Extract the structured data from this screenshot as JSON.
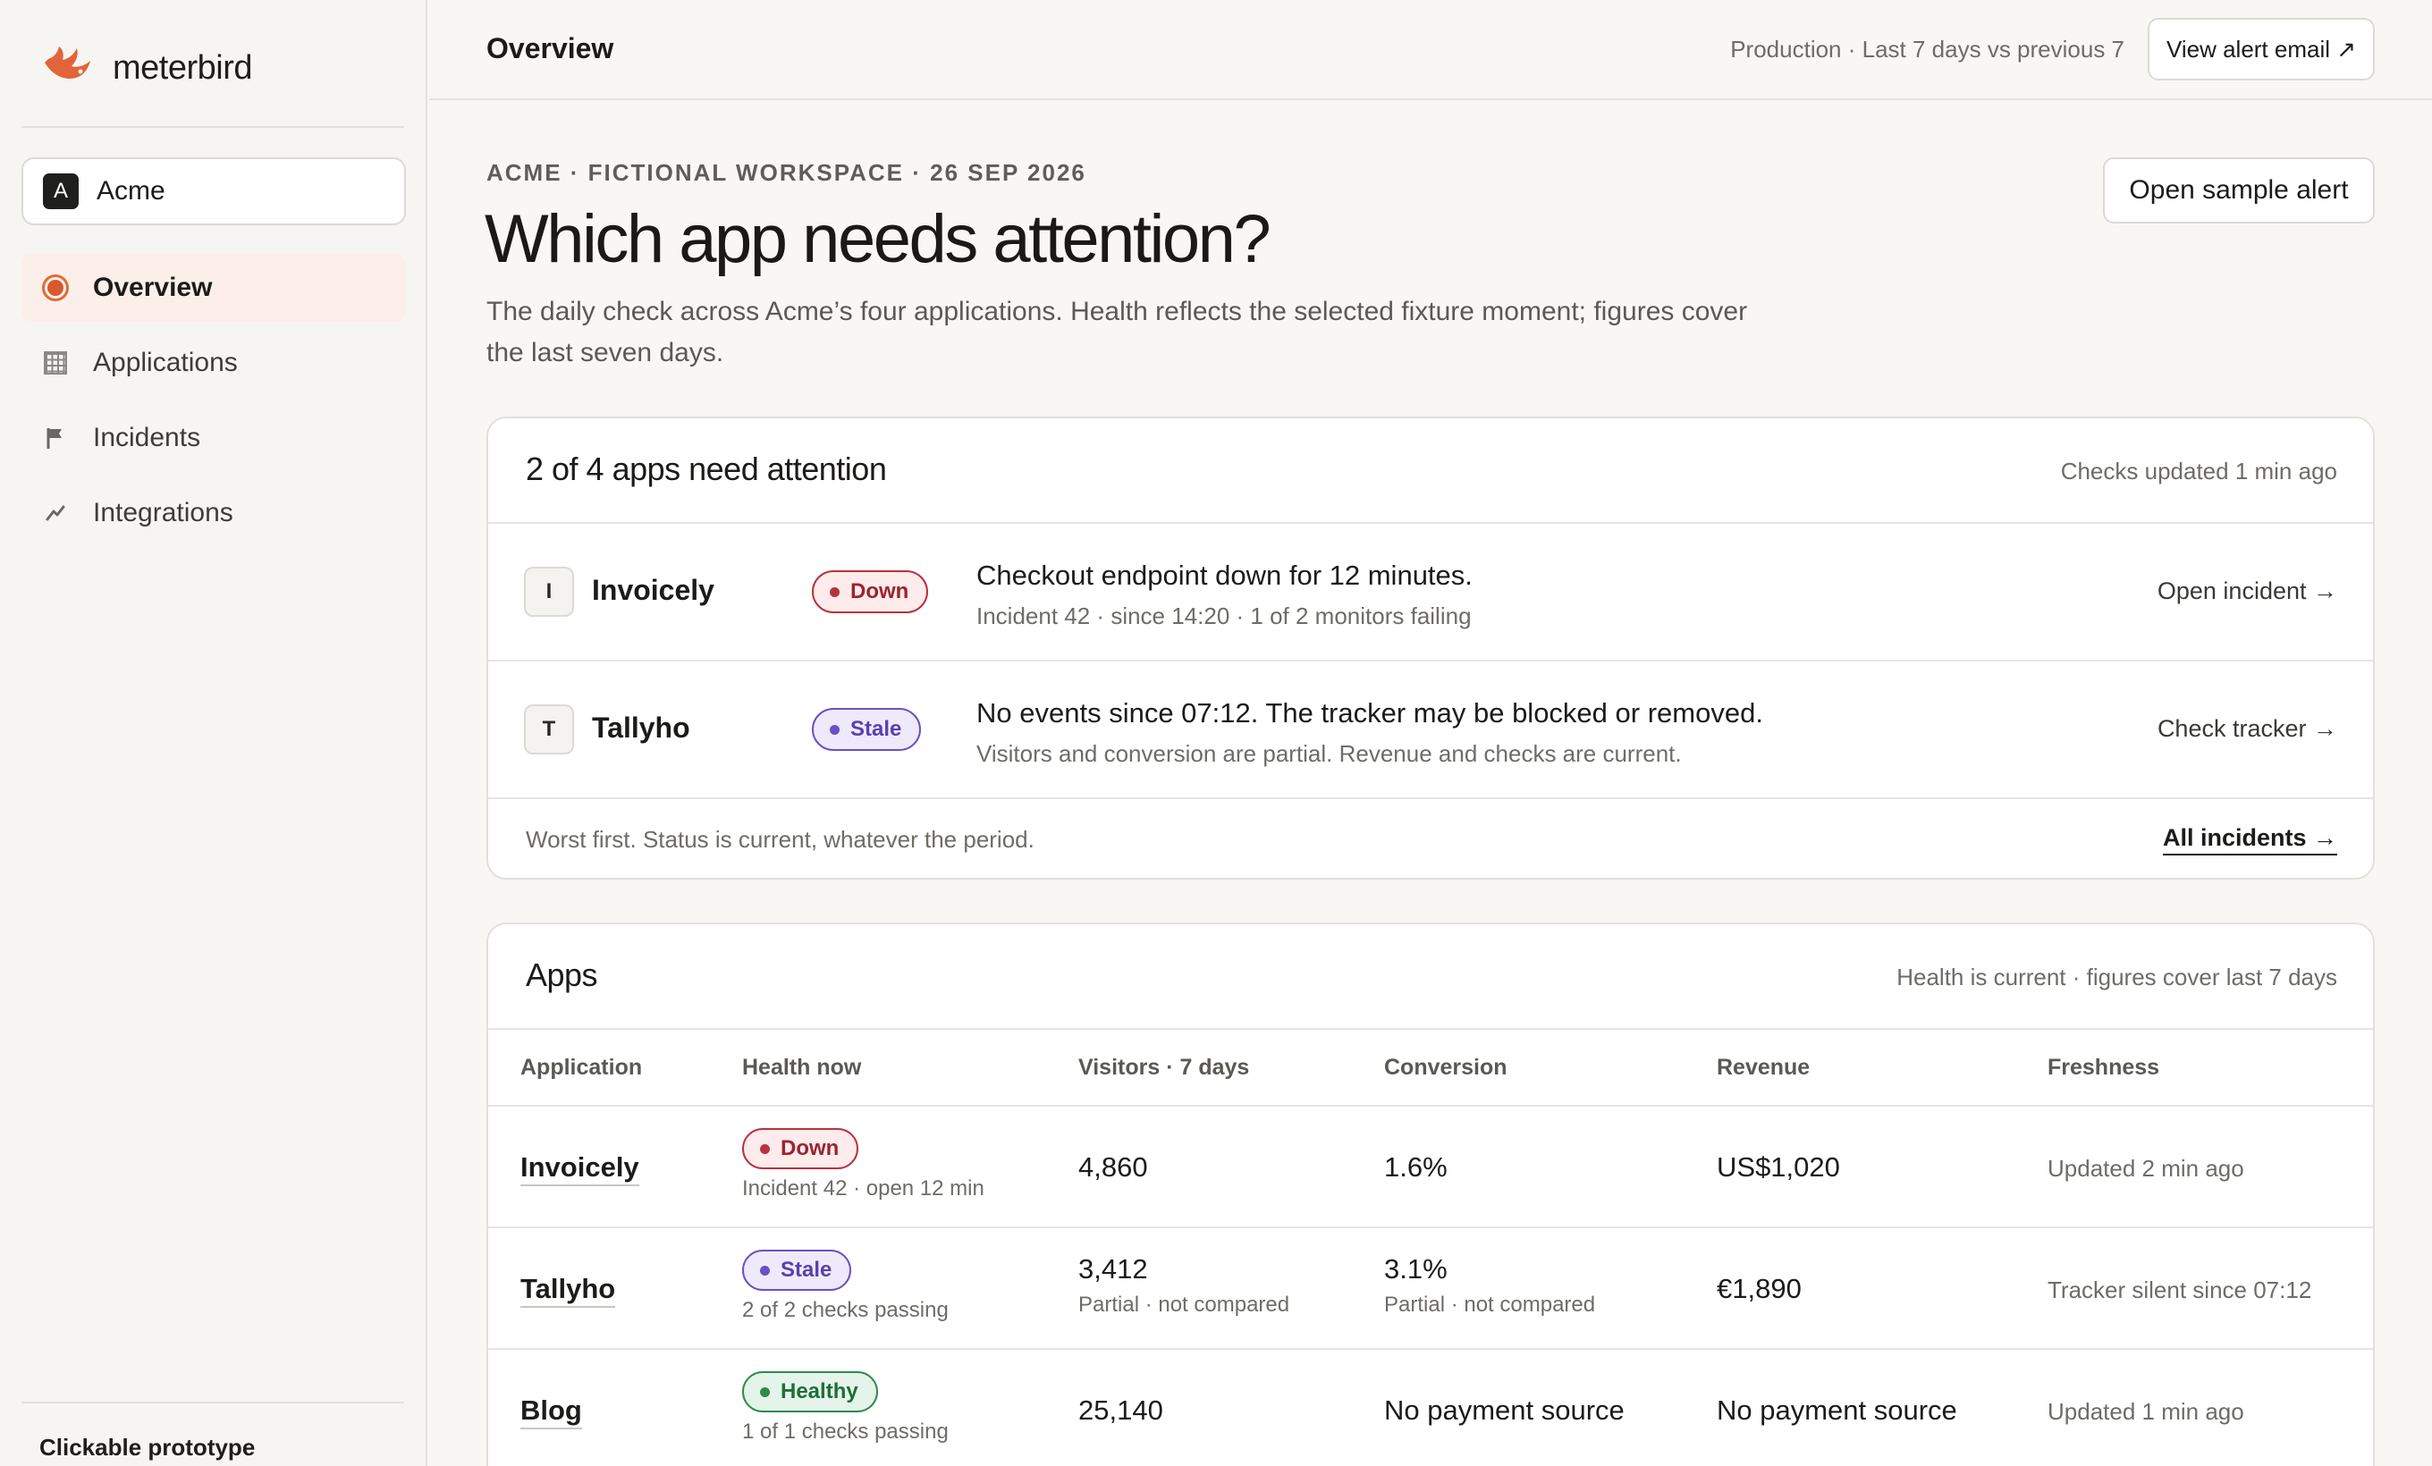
{
  "brand": {
    "name": "meterbird",
    "accent": "#e2643a"
  },
  "workspace": {
    "initial": "A",
    "name": "Acme"
  },
  "nav": [
    {
      "label": "Overview",
      "icon": "target-icon",
      "active": true
    },
    {
      "label": "Applications",
      "icon": "grid-icon"
    },
    {
      "label": "Incidents",
      "icon": "flag-icon"
    },
    {
      "label": "Integrations",
      "icon": "plug-icon"
    }
  ],
  "sidebar_footer": "Clickable prototype",
  "topbar": {
    "title": "Overview",
    "context": "Production · Last 7 days vs previous 7",
    "alert_email_button": "View alert email ↗"
  },
  "hero": {
    "eyebrow": "ACME · FICTIONAL WORKSPACE · 26 SEP 2026",
    "title": "Which app needs attention?",
    "subtitle": "The daily check across Acme’s four applications. Health reflects the selected fixture moment; figures cover the last seven days.",
    "sample_alert_button": "Open sample alert"
  },
  "attention": {
    "title": "2 of 4 apps need attention",
    "meta": "Checks updated 1 min ago",
    "rows": [
      {
        "initial": "I",
        "name": "Invoicely",
        "status": "Down",
        "headline": "Checkout endpoint down for 12 minutes.",
        "detail": "Incident 42 · since 14:20 · 1 of 2 monitors failing",
        "action": "Open incident →"
      },
      {
        "initial": "T",
        "name": "Tallyho",
        "status": "Stale",
        "headline": "No events since 07:12. The tracker may be blocked or removed.",
        "detail": "Visitors and conversion are partial. Revenue and checks are current.",
        "action": "Check tracker →"
      }
    ],
    "footer_note": "Worst first. Status is current, whatever the period.",
    "footer_link": "All incidents →"
  },
  "apps": {
    "title": "Apps",
    "meta": "Health is current · figures cover last 7 days",
    "columns": [
      "Application",
      "Health now",
      "Visitors · 7 days",
      "Conversion",
      "Revenue",
      "Freshness"
    ],
    "rows": [
      {
        "name": "Invoicely",
        "status": "Down",
        "health_sub": "Incident 42 · open 12 min",
        "visitors": "4,860",
        "visitors_sub": "",
        "conversion": "1.6%",
        "conversion_sub": "",
        "revenue": "US$1,020",
        "freshness": "Updated 2 min ago"
      },
      {
        "name": "Tallyho",
        "status": "Stale",
        "health_sub": "2 of 2 checks passing",
        "visitors": "3,412",
        "visitors_sub": "Partial · not compared",
        "conversion": "3.1%",
        "conversion_sub": "Partial · not compared",
        "revenue": "€1,890",
        "freshness": "Tracker silent since 07:12"
      },
      {
        "name": "Blog",
        "status": "Healthy",
        "health_sub": "1 of 1 checks passing",
        "visitors": "25,140",
        "visitors_sub": "",
        "conversion": "No payment source",
        "conversion_sub": "",
        "revenue": "No payment source",
        "freshness": "Updated 1 min ago"
      }
    ]
  },
  "status_colors": {
    "down": "#b8323e",
    "stale": "#6b4fc7",
    "healthy": "#2f8a4e"
  }
}
